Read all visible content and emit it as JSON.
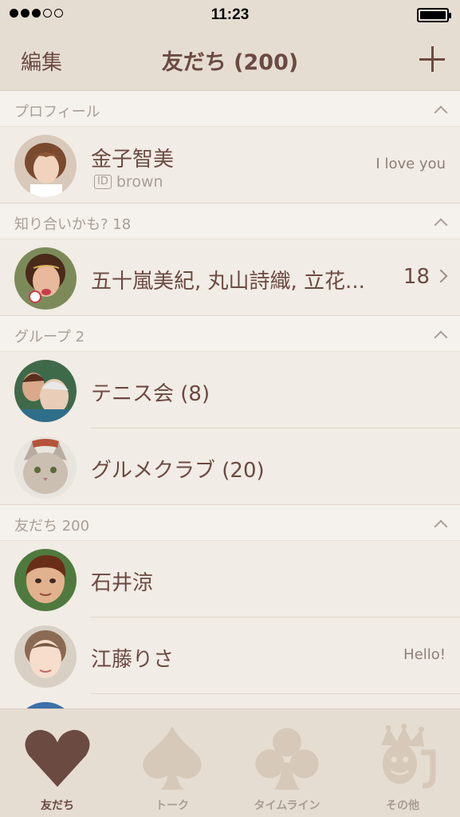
{
  "status": {
    "time": "11:23"
  },
  "nav": {
    "edit": "編集",
    "title": "友だち (200)",
    "add_icon": "plus-icon"
  },
  "sections": {
    "profile": {
      "label": "プロフィール"
    },
    "suggest": {
      "label": "知り合いかも? 18"
    },
    "groups": {
      "label": "グループ 2"
    },
    "friends": {
      "label": "友だち 200"
    }
  },
  "profile": {
    "name": "金子智美",
    "id_badge": "ID",
    "id": "brown",
    "status": "I love you"
  },
  "suggest": {
    "names": "五十嵐美紀, 丸山詩織, 立花...",
    "count": "18"
  },
  "groups": [
    {
      "name": "テニス会 (8)"
    },
    {
      "name": "グルメクラブ (20)"
    }
  ],
  "friends": [
    {
      "name": "石井涼",
      "status": ""
    },
    {
      "name": "江藤りさ",
      "status": "Hello!"
    }
  ],
  "tabs": [
    {
      "label": "友だち",
      "icon": "heart-icon"
    },
    {
      "label": "トーク",
      "icon": "spade-icon"
    },
    {
      "label": "タイムライン",
      "icon": "club-icon"
    },
    {
      "label": "その他",
      "icon": "joker-icon"
    }
  ],
  "colors": {
    "brand": "#6b4a42",
    "bar": "#e6ddd2",
    "bg": "#f1ece5",
    "muted": "#a89e97"
  }
}
